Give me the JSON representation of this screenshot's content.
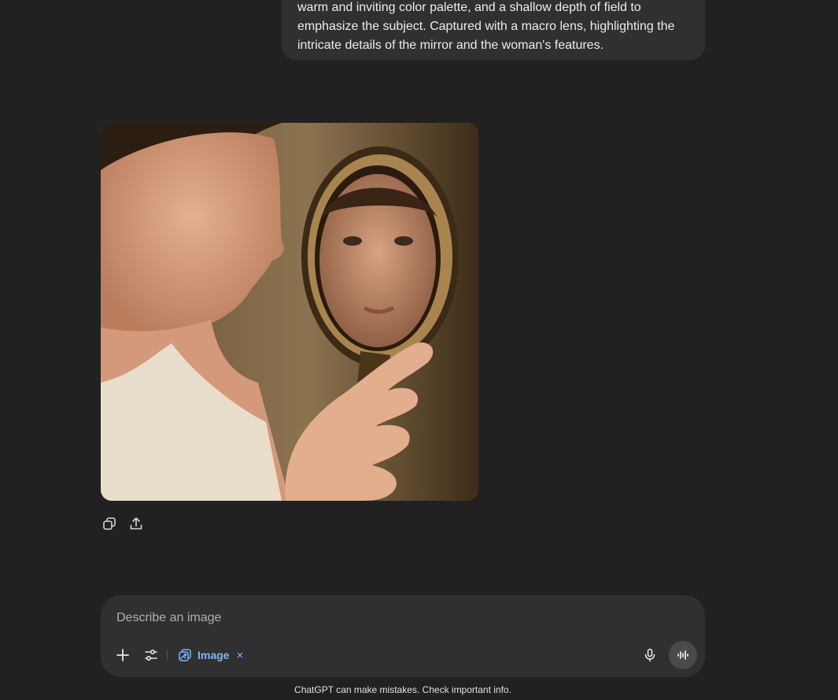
{
  "user_message": {
    "lines": [
      "warm and inviting color palette, and a shallow depth of field to",
      "emphasize the subject. Captured with a macro lens, highlighting the",
      "intricate details of the mirror and the woman's features."
    ]
  },
  "generated_image": {
    "icon": "generated-image"
  },
  "image_actions": {
    "copy_icon": "copy-icon",
    "share_icon": "share-icon"
  },
  "composer": {
    "placeholder": "Describe an image",
    "value": "",
    "plus_icon": "plus-icon",
    "tools_icon": "sliders-icon",
    "chip_label": "Image",
    "chip_close": "×",
    "mic_icon": "mic-icon",
    "voice_icon": "voice-mode-icon"
  },
  "footer": {
    "disclaimer": "ChatGPT can make mistakes. Check important info."
  },
  "colors": {
    "background": "#212121",
    "surface": "#303030",
    "accent": "#7ab7ff"
  }
}
